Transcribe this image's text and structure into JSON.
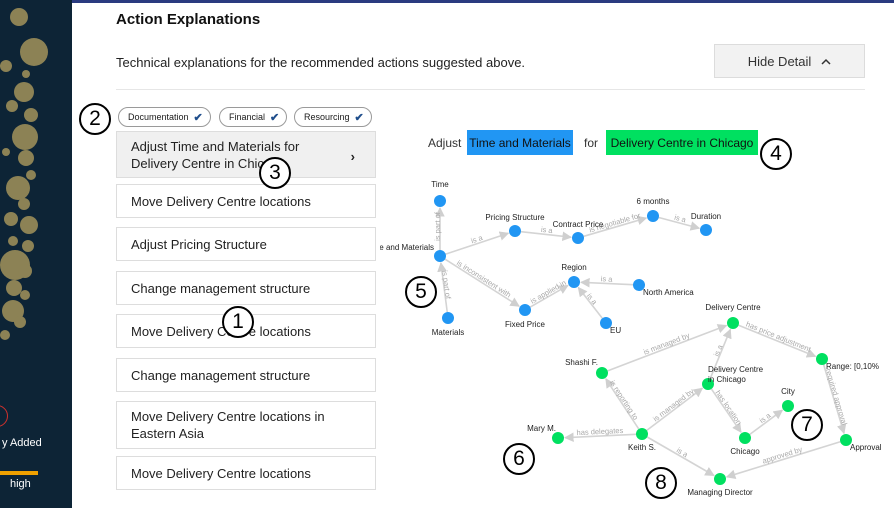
{
  "sidebar": {
    "legend_added": "y Added",
    "legend_high": "high"
  },
  "header": {
    "title": "Action Explanations",
    "subtitle": "Technical explanations for the recommended actions suggested above.",
    "hide_button_label": "Hide Detail",
    "hide_button_icon": "chevron-up-icon"
  },
  "filters": [
    {
      "label": "Documentation",
      "checked": true
    },
    {
      "label": "Financial",
      "checked": true
    },
    {
      "label": "Resourcing",
      "checked": true
    }
  ],
  "actions": [
    {
      "label": "Adjust Time and Materials for Delivery Centre in Chicago",
      "selected": true
    },
    {
      "label": "Move Delivery Centre locations"
    },
    {
      "label": "Adjust Pricing Structure"
    },
    {
      "label": "Change management structure"
    },
    {
      "label": "Move Delivery Centre locations"
    },
    {
      "label": "Change management structure"
    },
    {
      "label": "Move Delivery Centre locations in Eastern Asia"
    },
    {
      "label": "Move Delivery Centre locations"
    }
  ],
  "explanation": {
    "adjust_label": "Adjust",
    "material": "Time and Materials",
    "for_label": "for",
    "location": "Delivery Centre in Chicago"
  },
  "colors": {
    "blue_node": "#2196f3",
    "green_node": "#00e060",
    "edge": "#d4d4d4",
    "sidebar_bg": "#0d2436"
  },
  "graph": {
    "nodes": [
      {
        "id": "time",
        "label": "Time",
        "group": "blue"
      },
      {
        "id": "tm",
        "label": "Time and Materials",
        "group": "blue"
      },
      {
        "id": "ps",
        "label": "Pricing Structure",
        "group": "blue"
      },
      {
        "id": "cp",
        "label": "Contract Price",
        "group": "blue"
      },
      {
        "id": "sixm",
        "label": "6 months",
        "group": "blue"
      },
      {
        "id": "dur",
        "label": "Duration",
        "group": "blue"
      },
      {
        "id": "mat",
        "label": "Materials",
        "group": "blue"
      },
      {
        "id": "fp",
        "label": "Fixed Price",
        "group": "blue"
      },
      {
        "id": "reg",
        "label": "Region",
        "group": "blue"
      },
      {
        "id": "na",
        "label": "North America",
        "group": "blue"
      },
      {
        "id": "eu",
        "label": "EU",
        "group": "blue"
      },
      {
        "id": "dc",
        "label": "Delivery Centre",
        "group": "green"
      },
      {
        "id": "range",
        "label": "Range: [0,10%",
        "group": "green"
      },
      {
        "id": "shashi",
        "label": "Shashi F.",
        "group": "green"
      },
      {
        "id": "dcc",
        "label": "Delivery Centre in Chicago",
        "group": "green"
      },
      {
        "id": "city",
        "label": "City",
        "group": "green"
      },
      {
        "id": "mary",
        "label": "Mary M.",
        "group": "green"
      },
      {
        "id": "keith",
        "label": "Keith S.",
        "group": "green"
      },
      {
        "id": "chicago",
        "label": "Chicago",
        "group": "green"
      },
      {
        "id": "approval",
        "label": "Approval",
        "group": "green"
      },
      {
        "id": "md",
        "label": "Managing Director",
        "group": "green"
      }
    ],
    "edges": [
      {
        "from": "tm",
        "to": "time",
        "label": "is part of"
      },
      {
        "from": "tm",
        "to": "ps",
        "label": "is a"
      },
      {
        "from": "ps",
        "to": "cp",
        "label": "is a"
      },
      {
        "from": "cp",
        "to": "sixm",
        "label": "is negotiable for"
      },
      {
        "from": "sixm",
        "to": "dur",
        "label": "is a"
      },
      {
        "from": "mat",
        "to": "tm",
        "label": "is part of"
      },
      {
        "from": "tm",
        "to": "fp",
        "label": "is inconsistent with"
      },
      {
        "from": "fp",
        "to": "reg",
        "label": "is applied in"
      },
      {
        "from": "na",
        "to": "reg",
        "label": "is a"
      },
      {
        "from": "eu",
        "to": "reg",
        "label": "is a"
      },
      {
        "from": "shashi",
        "to": "dc",
        "label": "is managed by"
      },
      {
        "from": "dc",
        "to": "range",
        "label": "has price adjustment"
      },
      {
        "from": "dcc",
        "to": "dc",
        "label": "is a"
      },
      {
        "from": "range",
        "to": "approval",
        "label": "required approval"
      },
      {
        "from": "keith",
        "to": "shashi",
        "label": "is reporting to"
      },
      {
        "from": "keith",
        "to": "dcc",
        "label": "is managed by"
      },
      {
        "from": "dcc",
        "to": "chicago",
        "label": "has location"
      },
      {
        "from": "chicago",
        "to": "city",
        "label": "is a"
      },
      {
        "from": "keith",
        "to": "mary",
        "label": "has delegates"
      },
      {
        "from": "keith",
        "to": "md",
        "label": "is a"
      },
      {
        "from": "approval",
        "to": "md",
        "label": "approved by"
      }
    ]
  }
}
